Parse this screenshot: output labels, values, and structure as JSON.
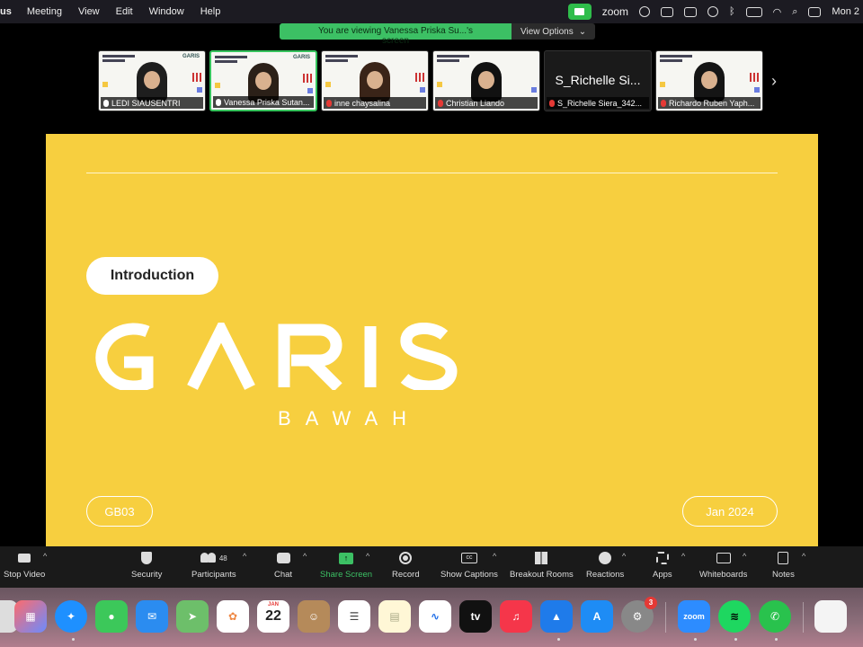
{
  "menubar": {
    "app_name": "us",
    "items": [
      "Meeting",
      "View",
      "Edit",
      "Window",
      "Help"
    ],
    "zoom_label": "zoom",
    "clock": "Mon 2"
  },
  "viewing_banner": {
    "message": "You are viewing Vanessa Priska Su...'s screen",
    "options_label": "View Options"
  },
  "participants": [
    {
      "name": "LEDI SIAUSENTRI",
      "muted": false
    },
    {
      "name": "Vanessa Priska Sutan...",
      "muted": false,
      "active": true
    },
    {
      "name": "inne chaysalina",
      "muted": true
    },
    {
      "name": "Christian Liando",
      "muted": true
    },
    {
      "name": "S_Richelle Siera_342...",
      "display_name": "S_Richelle Si...",
      "muted": true,
      "video_off": true
    },
    {
      "name": "Richardo Ruben Yaph...",
      "muted": true
    }
  ],
  "slide": {
    "tag": "Introduction",
    "logo_text": "GARIS",
    "logo_sub": "BAWAH",
    "code": "GB03",
    "date": "Jan 2024",
    "background_color": "#f7cf3f"
  },
  "toolbar": {
    "stop_video": "Stop Video",
    "security": "Security",
    "participants": "Participants",
    "participants_count": "48",
    "chat": "Chat",
    "share_screen": "Share Screen",
    "record": "Record",
    "show_captions": "Show Captions",
    "breakout_rooms": "Breakout Rooms",
    "reactions": "Reactions",
    "apps": "Apps",
    "whiteboards": "Whiteboards",
    "notes": "Notes"
  },
  "dock": {
    "calendar_month": "JAN",
    "calendar_day": "22",
    "tv_label": "tv",
    "zoom_label": "zoom",
    "settings_badge": "3"
  },
  "colors": {
    "accent_green": "#3cc064",
    "muted_red": "#e53935"
  }
}
